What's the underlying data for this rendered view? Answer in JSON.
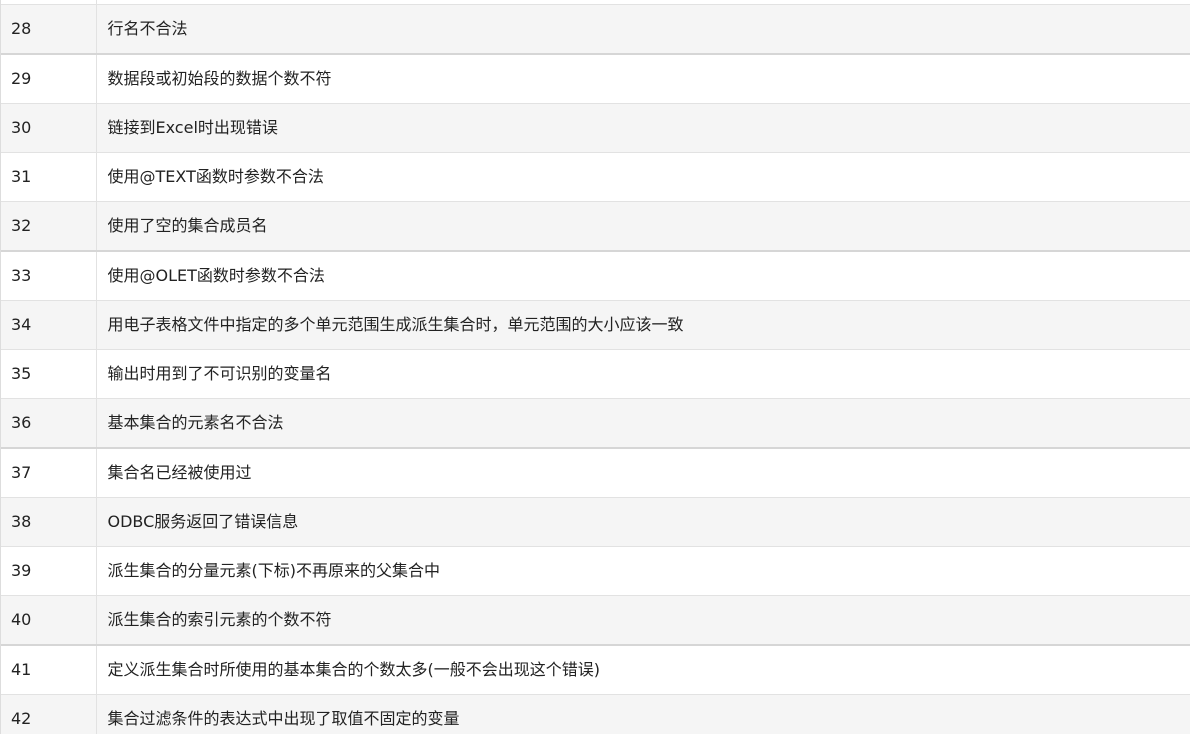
{
  "table": {
    "rows": [
      {
        "code": "28",
        "message": "行名不合法"
      },
      {
        "code": "29",
        "message": "数据段或初始段的数据个数不符"
      },
      {
        "code": "30",
        "message": "链接到Excel时出现错误"
      },
      {
        "code": "31",
        "message": "使用@TEXT函数时参数不合法"
      },
      {
        "code": "32",
        "message": "使用了空的集合成员名"
      },
      {
        "code": "33",
        "message": "使用@OLET函数时参数不合法"
      },
      {
        "code": "34",
        "message": "用电子表格文件中指定的多个单元范围生成派生集合时，单元范围的大小应该一致"
      },
      {
        "code": "35",
        "message": "输出时用到了不可识别的变量名"
      },
      {
        "code": "36",
        "message": "基本集合的元素名不合法"
      },
      {
        "code": "37",
        "message": "集合名已经被使用过"
      },
      {
        "code": "38",
        "message": "ODBC服务返回了错误信息"
      },
      {
        "code": "39",
        "message": "派生集合的分量元素(下标)不再原来的父集合中"
      },
      {
        "code": "40",
        "message": "派生集合的索引元素的个数不符"
      },
      {
        "code": "41",
        "message": "定义派生集合时所使用的基本集合的个数太多(一般不会出现这个错误)"
      },
      {
        "code": "42",
        "message": "集合过滤条件的表达式中出现了取值不固定的变量"
      }
    ]
  }
}
